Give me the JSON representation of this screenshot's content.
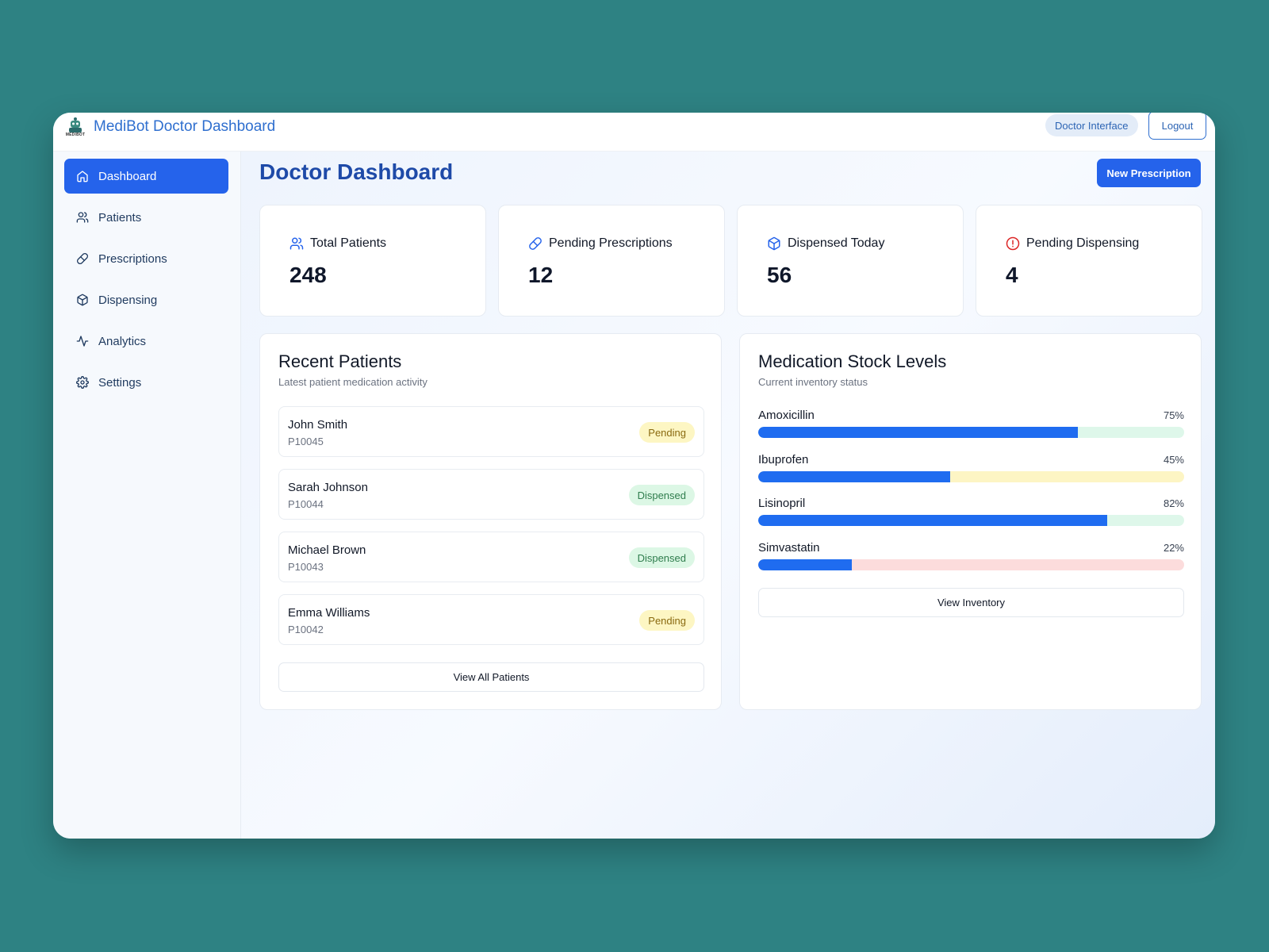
{
  "app": {
    "title": "MediBot Doctor Dashboard",
    "logo_text": "MEDIBOT",
    "role_badge": "Doctor Interface",
    "logout_label": "Logout"
  },
  "sidebar": {
    "items": [
      {
        "label": "Dashboard",
        "icon": "home-icon",
        "active": true
      },
      {
        "label": "Patients",
        "icon": "users-icon",
        "active": false
      },
      {
        "label": "Prescriptions",
        "icon": "pill-icon",
        "active": false
      },
      {
        "label": "Dispensing",
        "icon": "package-icon",
        "active": false
      },
      {
        "label": "Analytics",
        "icon": "activity-icon",
        "active": false
      },
      {
        "label": "Settings",
        "icon": "gear-icon",
        "active": false
      }
    ]
  },
  "main": {
    "title": "Doctor Dashboard",
    "primary_action": "New Prescription",
    "stats": [
      {
        "label": "Total Patients",
        "value": "248",
        "icon": "users-icon",
        "color": "#2563eb"
      },
      {
        "label": "Pending Prescriptions",
        "value": "12",
        "icon": "pill-icon",
        "color": "#2563eb"
      },
      {
        "label": "Dispensed Today",
        "value": "56",
        "icon": "package-icon",
        "color": "#2563eb"
      },
      {
        "label": "Pending Dispensing",
        "value": "4",
        "icon": "alert-circle-icon",
        "color": "#dc2626"
      }
    ],
    "recent_patients": {
      "title": "Recent Patients",
      "subtitle": "Latest patient medication activity",
      "rows": [
        {
          "name": "John Smith",
          "id": "P10045",
          "status": "Pending"
        },
        {
          "name": "Sarah Johnson",
          "id": "P10044",
          "status": "Dispensed"
        },
        {
          "name": "Michael Brown",
          "id": "P10043",
          "status": "Dispensed"
        },
        {
          "name": "Emma Williams",
          "id": "P10042",
          "status": "Pending"
        }
      ],
      "action": "View All Patients"
    },
    "stock": {
      "title": "Medication Stock Levels",
      "subtitle": "Current inventory status",
      "items": [
        {
          "name": "Amoxicillin",
          "percent": 75,
          "label": "75%",
          "track_color": "#def7ea"
        },
        {
          "name": "Ibuprofen",
          "percent": 45,
          "label": "45%",
          "track_color": "#fdf5c4"
        },
        {
          "name": "Lisinopril",
          "percent": 82,
          "label": "82%",
          "track_color": "#def7ea"
        },
        {
          "name": "Simvastatin",
          "percent": 22,
          "label": "22%",
          "track_color": "#fcdcdc"
        }
      ],
      "action": "View Inventory"
    }
  },
  "colors": {
    "accent": "#2563eb",
    "pending_bg": "#fdf6c3",
    "dispensed_bg": "#dcf7e5",
    "alert": "#dc2626"
  }
}
